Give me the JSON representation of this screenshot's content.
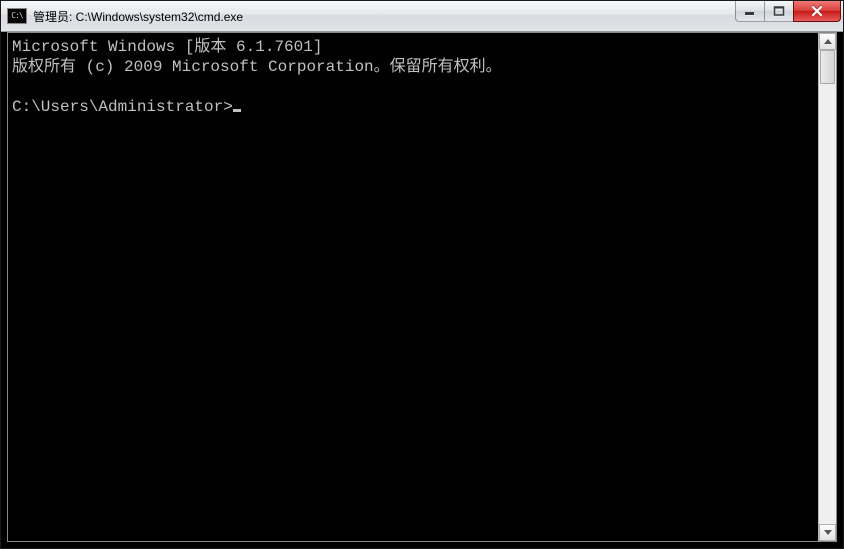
{
  "window": {
    "title": "管理员: C:\\Windows\\system32\\cmd.exe"
  },
  "console": {
    "line1": "Microsoft Windows [版本 6.1.7601]",
    "line2": "版权所有 (c) 2009 Microsoft Corporation。保留所有权利。",
    "blank": "",
    "prompt": "C:\\Users\\Administrator>"
  }
}
